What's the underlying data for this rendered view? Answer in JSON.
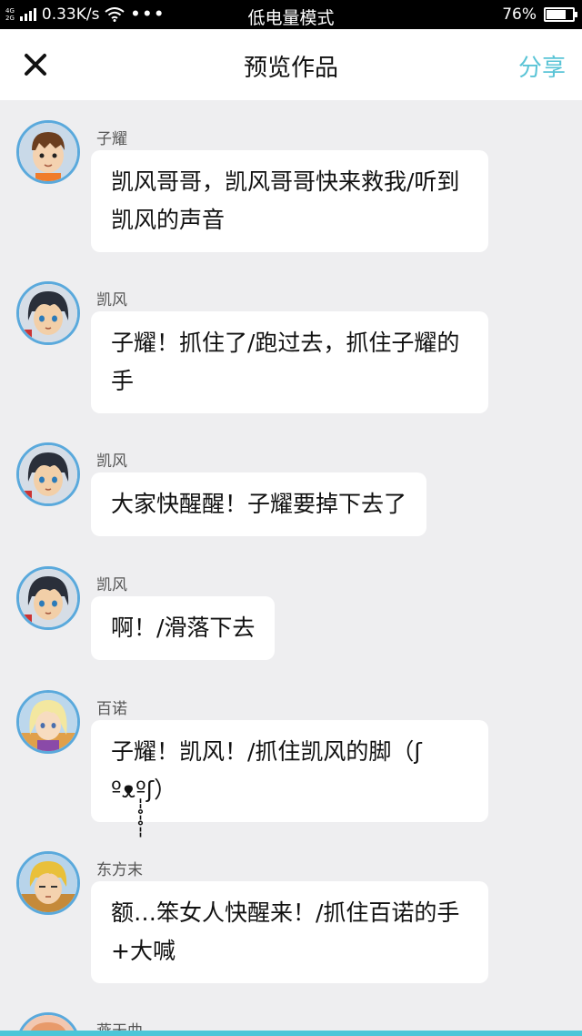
{
  "status_bar": {
    "network_top": "4G",
    "network_bottom": "2G",
    "speed": "0.33K/s",
    "dots": "•••",
    "mode": "低电量模式",
    "battery_percent": "76%",
    "battery_level": 0.76
  },
  "header": {
    "title": "预览作品",
    "share_label": "分享",
    "accent_color": "#5ac4d6"
  },
  "messages": [
    {
      "sender": "子耀",
      "text": "凯风哥哥，凯风哥哥快来救我/听到凯风的声音",
      "avatar_icon": "boy-brown-hair-avatar-icon"
    },
    {
      "sender": "凯风",
      "text": "子耀！抓住了/跑过去，抓住子耀的手",
      "avatar_icon": "boy-dark-hair-avatar-icon"
    },
    {
      "sender": "凯风",
      "text": "大家快醒醒！子耀要掉下去了",
      "avatar_icon": "boy-dark-hair-avatar-icon"
    },
    {
      "sender": "凯风",
      "text": "啊！/滑落下去",
      "avatar_icon": "boy-dark-hair-avatar-icon"
    },
    {
      "sender": "百诺",
      "text": "子耀！凯风！/抓住凯风的脚（ʃ ºᴥº̩̩̥̩̥̩̩ʃ）",
      "avatar_icon": "girl-blonde-avatar-icon"
    },
    {
      "sender": "东方末",
      "text": "额…笨女人快醒来！/抓住百诺的手+大喊",
      "avatar_icon": "boy-blonde-avatar-icon"
    },
    {
      "sender": "燕天曲",
      "text": "",
      "avatar_icon": "partial-avatar-icon"
    }
  ]
}
